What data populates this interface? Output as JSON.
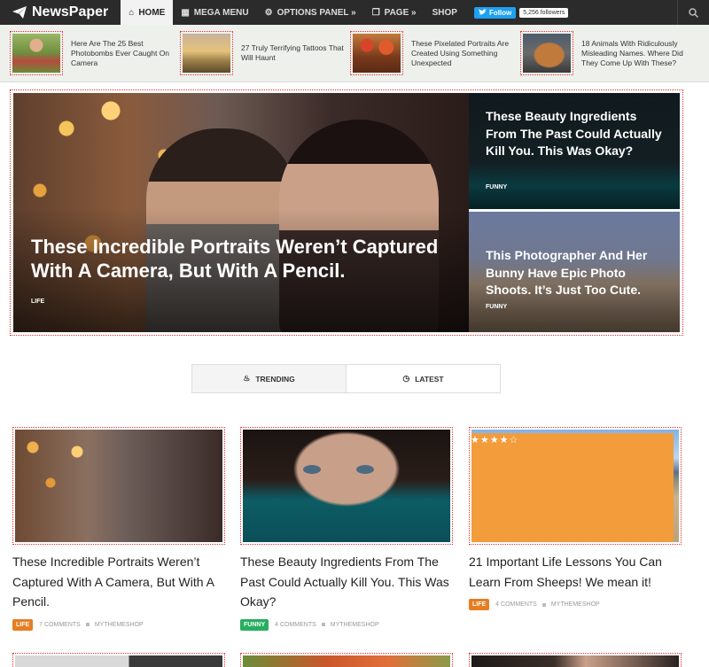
{
  "brand": {
    "name": "NewsPaper"
  },
  "nav": {
    "items": [
      {
        "label": "Home",
        "icon": "home-icon"
      },
      {
        "label": "Mega Menu",
        "icon": "grid-icon"
      },
      {
        "label": "Options Panel »",
        "icon": "gear-icon"
      },
      {
        "label": "Page »",
        "icon": "copy-icon"
      },
      {
        "label": "Shop",
        "icon": ""
      }
    ]
  },
  "social": {
    "follow_label": "Follow",
    "followers": "5,256 followers"
  },
  "ticker": [
    {
      "title": "Here Are The 25 Best Photobombs Ever Caught On Camera"
    },
    {
      "title": "27 Truly Terrifying Tattoos That Will Haunt"
    },
    {
      "title": "These Pixelated Portraits Are Created Using Something Unexpected"
    },
    {
      "title": "18 Animals With Ridiculously Misleading Names. Where Did They Come Up With These?"
    }
  ],
  "hero": {
    "main": {
      "title": "These Incredible Portraits Weren’t Captured With A Camera, But With A Pencil.",
      "category": "Life"
    },
    "side": [
      {
        "title": "These Beauty Ingredients From The Past Could Actually Kill You. This Was Okay?",
        "category": "Funny"
      },
      {
        "title": "This Photographer And Her Bunny Have Epic Photo Shoots. It’s Just Too Cute.",
        "category": "Funny"
      }
    ]
  },
  "tabs": [
    {
      "label": "Trending"
    },
    {
      "label": "Latest"
    }
  ],
  "cards": [
    {
      "title": "These Incredible Portraits Weren’t Captured With A Camera, But With A Pencil.",
      "category": "Life",
      "comments": "7 Comments",
      "author": "MyThemeShop",
      "badge_color": "#e67e22"
    },
    {
      "title": "These Beauty Ingredients From The Past Could Actually Kill You. This Was Okay?",
      "category": "Funny",
      "comments": "4 Comments",
      "author": "MyThemeShop",
      "badge_color": "#27ae60"
    },
    {
      "title": "21 Important Life Lessons You Can Learn From Sheeps! We mean it!",
      "category": "Life",
      "comments": "4 Comments",
      "author": "MyThemeShop",
      "badge_color": "#e67e22",
      "rating_stars": "★★★★☆"
    }
  ],
  "colors": {
    "topbar": "#2b2b2b",
    "accent_red": "#d33",
    "life": "#e67e22",
    "funny": "#27ae60"
  }
}
